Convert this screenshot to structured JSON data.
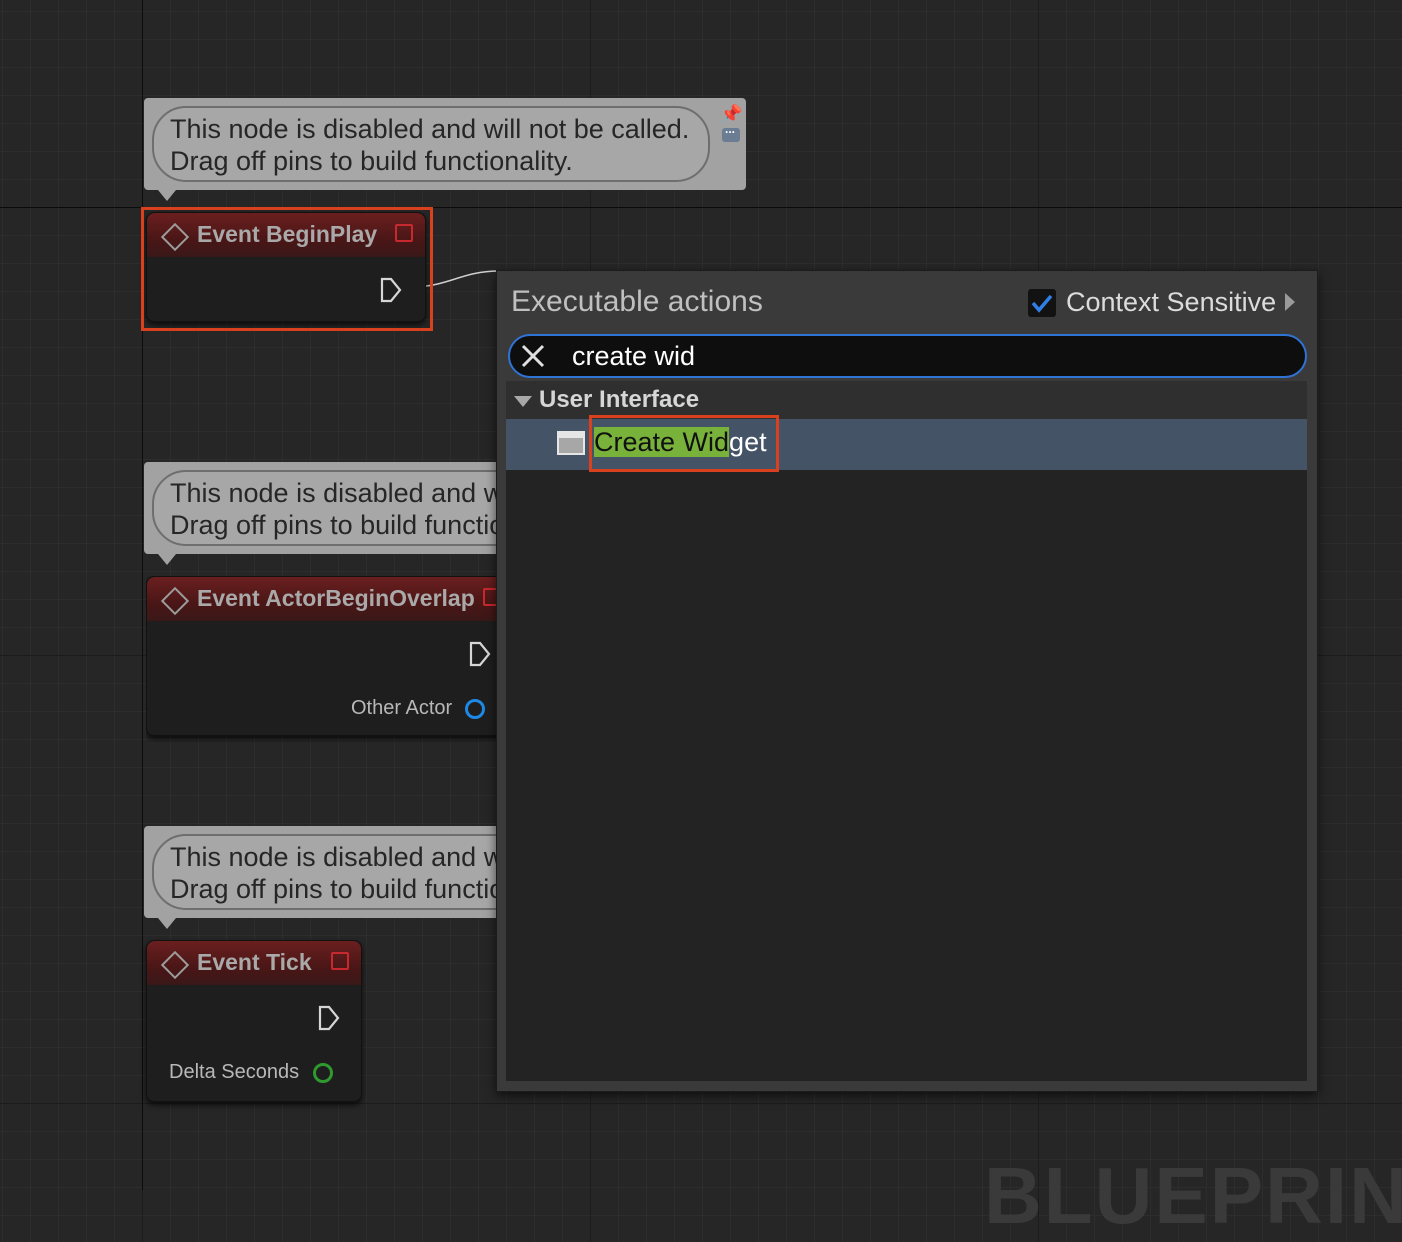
{
  "comments": [
    {
      "line1": "This node is disabled and will not be called.",
      "line2": "Drag off pins to build functionality."
    },
    {
      "line1": "This node is disabled and will not be called.",
      "line2": "Drag off pins to build functionality."
    },
    {
      "line1": "This node is disabled and will not be called.",
      "line2": "Drag off pins to build functionality."
    }
  ],
  "nodes": {
    "begin_play": {
      "title": "Event BeginPlay"
    },
    "actor_begin_overlap": {
      "title": "Event ActorBeginOverlap",
      "pin_label": "Other Actor"
    },
    "tick": {
      "title": "Event Tick",
      "pin_label": "Delta Seconds"
    }
  },
  "popup": {
    "title": "Executable actions",
    "context_sensitive": {
      "label": "Context Sensitive",
      "checked": true
    },
    "search": {
      "value": "create wid"
    },
    "category": "User Interface",
    "result": {
      "match": "Create Wid",
      "rest": "get"
    }
  },
  "watermark": "BLUEPRINT",
  "colors": {
    "selection_frame": "#d8401e",
    "search_border": "#2f73d6",
    "match_highlight": "#78b23b",
    "selected_row": "#445366",
    "object_pin": "#1e88e5",
    "float_pin": "#2e9a2e"
  }
}
